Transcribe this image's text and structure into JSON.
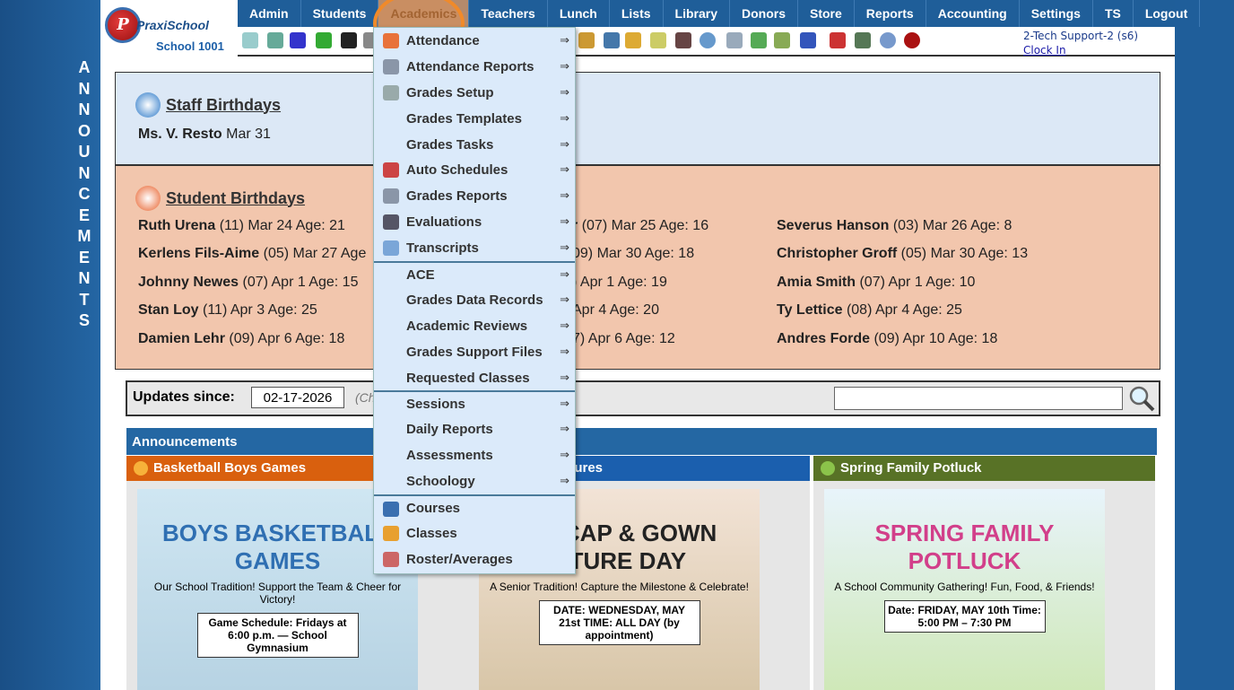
{
  "sidebar": {
    "vertical_label": "ANNOUNCEMENTS"
  },
  "logo": {
    "text": "PraxiSchool",
    "school": "School 1001"
  },
  "nav": {
    "items": [
      "Admin",
      "Students",
      "Academics",
      "Teachers",
      "Lunch",
      "Lists",
      "Library",
      "Donors",
      "Store",
      "Reports",
      "Accounting",
      "Settings",
      "TS",
      "Logout"
    ],
    "active": "Academics"
  },
  "toolbar": {
    "icons": [
      "search-icon",
      "calendar-icon",
      "at-email-icon",
      "chat-icon",
      "phone-icon",
      "speaker-icon",
      "burger-icon",
      "book-icon",
      "bell-icon",
      "note-arrow-icon",
      "person-icon",
      "alarm-clock-icon",
      "calculator-icon",
      "card-icon",
      "printer-card-icon",
      "ap-icon",
      "pdf-icon",
      "cash-register-icon",
      "help-icon",
      "alert-icon"
    ]
  },
  "user": {
    "name": "2-Tech Support-2 (s6)",
    "clock_in": "Clock In"
  },
  "staff_birthdays": {
    "title": "Staff Birthdays",
    "people": [
      {
        "name": "Ms. V. Resto",
        "detail": "Mar 31"
      }
    ]
  },
  "student_birthdays": {
    "title": "Student Birthdays",
    "columns": [
      [
        {
          "name": "Ruth Urena",
          "detail": "(11) Mar 24 Age: 21"
        },
        {
          "name": "Kerlens Fils-Aime",
          "detail": "(05) Mar 27 Age"
        },
        {
          "name": "Johnny Newes",
          "detail": "(07) Apr 1 Age: 15"
        },
        {
          "name": "Stan Loy",
          "detail": "(11) Apr 3 Age: 25"
        },
        {
          "name": "Damien Lehr",
          "detail": "(09) Apr 6 Age: 18"
        }
      ],
      [
        {
          "name": "r",
          "detail": "(07) Mar 25 Age: 16"
        },
        {
          "name": "",
          "detail": "09) Mar 30 Age: 18"
        },
        {
          "name": "",
          "detail": ") Apr 1 Age: 19"
        },
        {
          "name": "",
          "detail": "Apr 4 Age: 20"
        },
        {
          "name": "",
          "detail": "7) Apr 6 Age: 12"
        }
      ],
      [
        {
          "name": "Severus Hanson",
          "detail": "(03) Mar 26 Age: 8"
        },
        {
          "name": "Christopher Groff",
          "detail": "(05) Mar 30 Age: 13"
        },
        {
          "name": "Amia Smith",
          "detail": "(07) Apr 1 Age: 10"
        },
        {
          "name": "Ty Lettice",
          "detail": "(08) Apr 4 Age: 25"
        },
        {
          "name": "Andres Forde",
          "detail": "(09) Apr 10 Age: 18"
        }
      ]
    ]
  },
  "updates": {
    "label": "Updates since:",
    "date": "02-17-2026",
    "hint": "(Ch",
    "search_value": ""
  },
  "announcements": {
    "title": "Announcements",
    "cards": [
      {
        "title": "Basketball Boys Games",
        "color": "#d9600e",
        "poster": {
          "headline": "BOYS BASKETBALL GAMES",
          "sub": "Our School Tradition! Support the Team & Cheer for Victory!",
          "box": "Game Schedule: Fridays at 6:00 p.m. — School Gymnasium"
        }
      },
      {
        "title": "& Gown Pictures",
        "color": "#1b5fae",
        "poster": {
          "headline": "OR CAP & GOWN CTURE DAY",
          "sub": "A Senior Tradition! Capture the Milestone & Celebrate!",
          "box": "DATE: WEDNESDAY, MAY 21st TIME: ALL DAY (by appointment)"
        }
      },
      {
        "title": "Spring Family Potluck",
        "color": "#587226",
        "poster": {
          "headline": "SPRING FAMILY POTLUCK",
          "sub": "A School Community Gathering! Fun, Food, & Friends!",
          "box": "Date: FRIDAY, MAY 10th Time: 5:00 PM – 7:30 PM"
        }
      }
    ]
  },
  "academics_menu": {
    "arrow": "⇒",
    "items": [
      {
        "label": "Attendance",
        "icon": "calendar-icon"
      },
      {
        "label": "Attendance Reports",
        "icon": "printer-icon"
      },
      {
        "label": "Grades Setup",
        "icon": "gear-icon"
      },
      {
        "label": "Grades Templates",
        "icon": ""
      },
      {
        "label": "Grades Tasks",
        "icon": ""
      },
      {
        "label": "Auto Schedules",
        "icon": "calendar-clock-icon"
      },
      {
        "label": "Grades Reports",
        "icon": "printer-icon"
      },
      {
        "label": "Evaluations",
        "icon": "checkbox-icon"
      },
      {
        "label": "Transcripts",
        "icon": "scroll-icon"
      },
      {
        "label": "ACE",
        "icon": "",
        "sep": true
      },
      {
        "label": "Grades Data Records",
        "icon": ""
      },
      {
        "label": "Academic Reviews",
        "icon": ""
      },
      {
        "label": "Grades Support Files",
        "icon": ""
      },
      {
        "label": "Requested Classes",
        "icon": ""
      },
      {
        "label": "Sessions",
        "icon": "",
        "sep": true
      },
      {
        "label": "Daily Reports",
        "icon": ""
      },
      {
        "label": "Assessments",
        "icon": ""
      },
      {
        "label": "Schoology",
        "icon": ""
      },
      {
        "label": "Courses",
        "icon": "book-icon",
        "sep": true,
        "noarrow": true
      },
      {
        "label": "Classes",
        "icon": "person-icon",
        "noarrow": true
      },
      {
        "label": "Roster/Averages",
        "icon": "roster-icon",
        "noarrow": true
      }
    ]
  }
}
